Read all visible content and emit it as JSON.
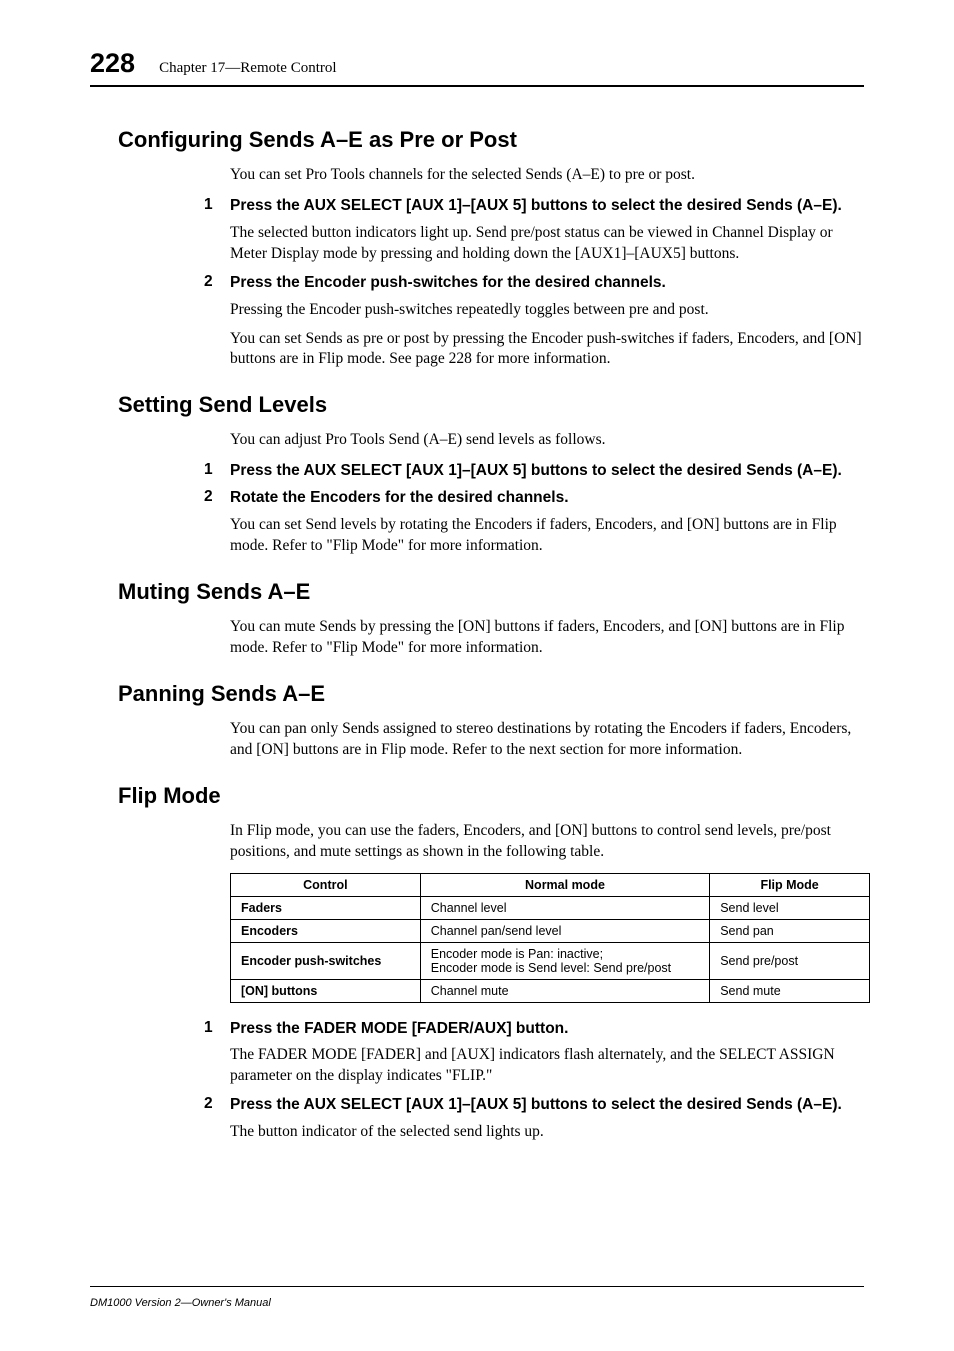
{
  "header": {
    "page_number": "228",
    "chapter": "Chapter 17—Remote Control"
  },
  "sections": {
    "configuring": {
      "heading": "Configuring Sends A–E as Pre or Post",
      "intro": "You can set Pro Tools channels for the selected Sends (A–E) to pre or post.",
      "step1_num": "1",
      "step1_label": "Press the AUX SELECT [AUX 1]–[AUX 5] buttons to select the desired Sends (A–E).",
      "step1_body": "The selected button indicators light up. Send pre/post status can be viewed in Channel Display or Meter Display mode by pressing and holding down the [AUX1]–[AUX5] buttons.",
      "step2_num": "2",
      "step2_label": "Press the Encoder push-switches for the desired channels.",
      "step2_body1": "Pressing the Encoder push-switches repeatedly toggles between pre and post.",
      "step2_body2": "You can set Sends as pre or post by pressing the Encoder push-switches if faders, Encoders, and [ON] buttons are in Flip mode. See page 228 for more information."
    },
    "setting": {
      "heading": "Setting Send Levels",
      "intro": "You can adjust Pro Tools Send (A–E) send levels as follows.",
      "step1_num": "1",
      "step1_label": "Press the AUX SELECT [AUX 1]–[AUX 5] buttons to select the desired Sends (A–E).",
      "step2_num": "2",
      "step2_label": "Rotate the Encoders for the desired channels.",
      "step2_body": "You can set Send levels by rotating the Encoders if faders, Encoders, and [ON] buttons are in Flip mode. Refer to \"Flip Mode\" for more information."
    },
    "muting": {
      "heading": "Muting Sends A–E",
      "body": "You can mute Sends by pressing the [ON] buttons if faders, Encoders, and [ON] buttons are in Flip mode. Refer to \"Flip Mode\" for more information."
    },
    "panning": {
      "heading": "Panning Sends A–E",
      "body": "You can pan only Sends assigned to stereo destinations by rotating the Encoders if faders, Encoders, and [ON] buttons are in Flip mode. Refer to the next section for more information."
    },
    "flip": {
      "heading": "Flip Mode",
      "intro": "In Flip mode, you can use the faders, Encoders, and [ON] buttons to control send levels, pre/post positions, and mute settings as shown in the following table.",
      "table": {
        "h1": "Control",
        "h2": "Normal mode",
        "h3": "Flip Mode",
        "r1c1": "Faders",
        "r1c2": "Channel level",
        "r1c3": "Send level",
        "r2c1": "Encoders",
        "r2c2": "Channel pan/send level",
        "r2c3": "Send pan",
        "r3c1": "Encoder push-switches",
        "r3c2": "Encoder mode is Pan: inactive;\nEncoder mode is Send level: Send pre/post",
        "r3c3": "Send pre/post",
        "r4c1": "[ON] buttons",
        "r4c2": "Channel mute",
        "r4c3": "Send mute"
      },
      "step1_num": "1",
      "step1_label": "Press the FADER MODE [FADER/AUX] button.",
      "step1_body": "The FADER MODE [FADER] and [AUX] indicators flash alternately, and the SELECT ASSIGN parameter on the display indicates \"FLIP.\"",
      "step2_num": "2",
      "step2_label": "Press the AUX SELECT [AUX 1]–[AUX 5] buttons to select the desired Sends (A–E).",
      "step2_body": "The button indicator of the selected send lights up."
    }
  },
  "footer": "DM1000 Version 2—Owner's Manual"
}
